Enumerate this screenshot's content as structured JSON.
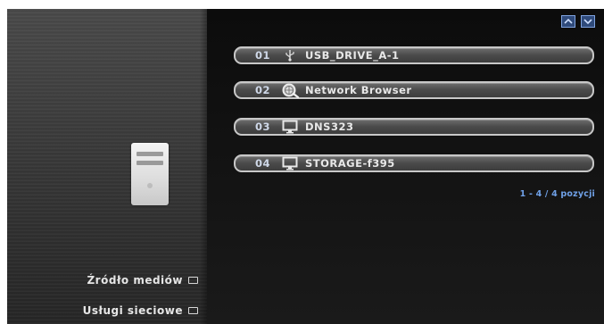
{
  "menu": {
    "items": [
      {
        "label": "Źródło mediów",
        "icon": "square-icon"
      },
      {
        "label": "Usługi sieciowe",
        "icon": "square-icon"
      }
    ]
  },
  "scroll": {
    "up_icon": "chevron-up-icon",
    "down_icon": "chevron-down-icon",
    "accent": "#7fa3e0"
  },
  "list": {
    "rows": [
      {
        "num": "01",
        "icon": "usb-icon",
        "label": "USB_DRIVE_A-1"
      },
      {
        "num": "02",
        "icon": "network-browser-icon",
        "label": "Network Browser"
      },
      {
        "num": "03",
        "icon": "monitor-icon",
        "label": "DNS323"
      },
      {
        "num": "04",
        "icon": "monitor-icon",
        "label": "STORAGE-f395"
      }
    ],
    "count_text": "1 - 4 / 4 pozycji",
    "count_color": "#6fa0e6"
  },
  "device": {
    "icon": "drive-tower-icon"
  }
}
